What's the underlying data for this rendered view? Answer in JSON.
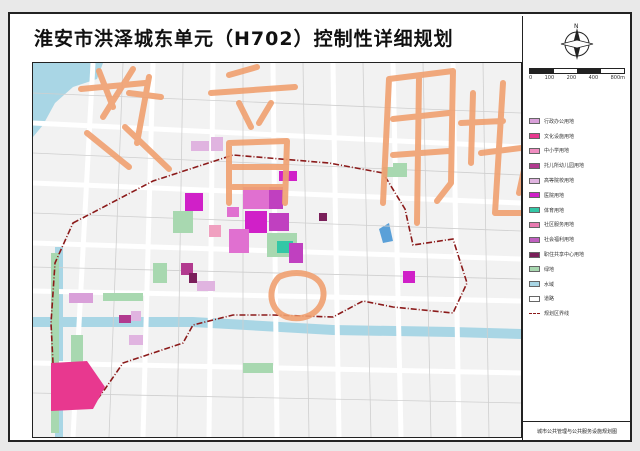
{
  "title": "淮安市洪泽城东单元（H702）控制性详细规划",
  "scale": {
    "ticks": [
      "0",
      "100",
      "200",
      "400",
      "800m"
    ]
  },
  "north_label": "N",
  "legend": {
    "items": [
      {
        "label": "行政办公用地",
        "color": "#d9a0d9",
        "kind": "box"
      },
      {
        "label": "文化设施用地",
        "color": "#e8388f",
        "kind": "box"
      },
      {
        "label": "中小学用地",
        "color": "#f08dc0",
        "kind": "box"
      },
      {
        "label": "托儿所幼儿园用地",
        "color": "#b23a8f",
        "kind": "box"
      },
      {
        "label": "高等院校用地",
        "color": "#e0b4e0",
        "kind": "box"
      },
      {
        "label": "医院用地",
        "color": "#d020c8",
        "kind": "box"
      },
      {
        "label": "体育用地",
        "color": "#33c7a6",
        "kind": "box"
      },
      {
        "label": "社区服务用地",
        "color": "#e87ab0",
        "kind": "box"
      },
      {
        "label": "社会福利用地",
        "color": "#c060c0",
        "kind": "box"
      },
      {
        "label": "职住共享中心用地",
        "color": "#7a1f5a",
        "kind": "box"
      },
      {
        "label": "绿地",
        "color": "#a8d8b0",
        "kind": "box"
      },
      {
        "label": "水域",
        "color": "#a9d6e5",
        "kind": "box"
      },
      {
        "label": "道路",
        "color": "#ffffff",
        "kind": "box"
      },
      {
        "label": "规划区界线",
        "color": "#8b1a1a",
        "kind": "line"
      }
    ]
  },
  "footer_label": "城市公共管理与公共服务设施规划图",
  "handwritten_text": "教育用地"
}
